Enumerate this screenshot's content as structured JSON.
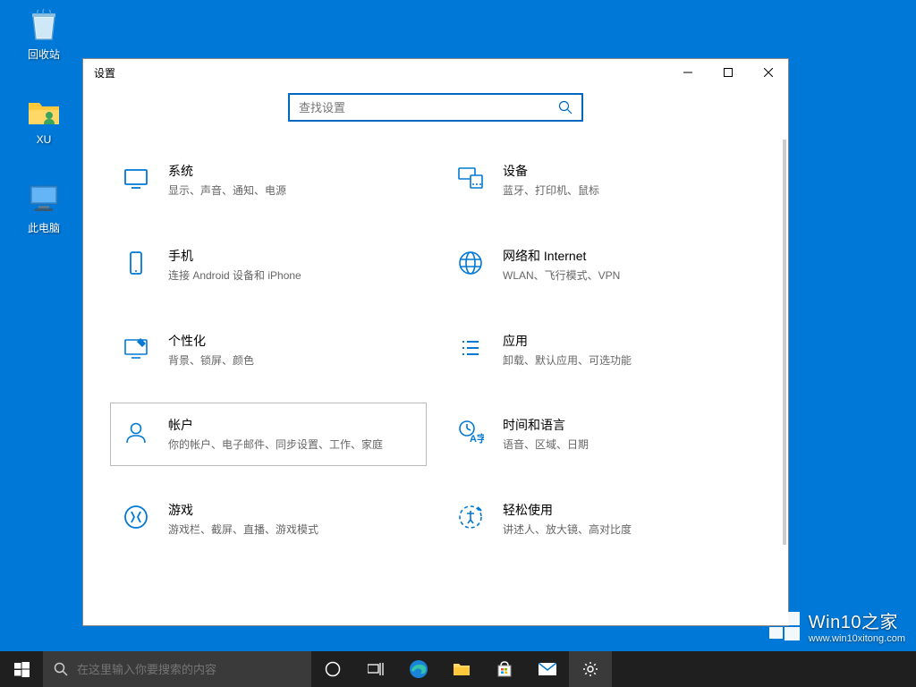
{
  "desktop": {
    "icons": [
      {
        "name": "recycle-bin",
        "label": "回收站"
      },
      {
        "name": "user-folder",
        "label": "XU"
      },
      {
        "name": "this-pc",
        "label": "此电脑"
      }
    ]
  },
  "window": {
    "title": "设置",
    "search_placeholder": "查找设置"
  },
  "tiles": [
    {
      "id": "system",
      "title": "系统",
      "desc": "显示、声音、通知、电源"
    },
    {
      "id": "devices",
      "title": "设备",
      "desc": "蓝牙、打印机、鼠标"
    },
    {
      "id": "phone",
      "title": "手机",
      "desc": "连接 Android 设备和 iPhone"
    },
    {
      "id": "network",
      "title": "网络和 Internet",
      "desc": "WLAN、飞行模式、VPN"
    },
    {
      "id": "personalization",
      "title": "个性化",
      "desc": "背景、锁屏、颜色"
    },
    {
      "id": "apps",
      "title": "应用",
      "desc": "卸载、默认应用、可选功能"
    },
    {
      "id": "accounts",
      "title": "帐户",
      "desc": "你的帐户、电子邮件、同步设置、工作、家庭"
    },
    {
      "id": "time-language",
      "title": "时间和语言",
      "desc": "语音、区域、日期"
    },
    {
      "id": "gaming",
      "title": "游戏",
      "desc": "游戏栏、截屏、直播、游戏模式"
    },
    {
      "id": "ease-of-access",
      "title": "轻松使用",
      "desc": "讲述人、放大镜、高对比度"
    }
  ],
  "hovered_tile": "accounts",
  "taskbar": {
    "search_placeholder": "在这里输入你要搜索的内容"
  },
  "watermark": {
    "title": "Win10之家",
    "url": "www.win10xitong.com"
  },
  "colors": {
    "accent": "#0078d4",
    "desktop": "#0078d7"
  }
}
